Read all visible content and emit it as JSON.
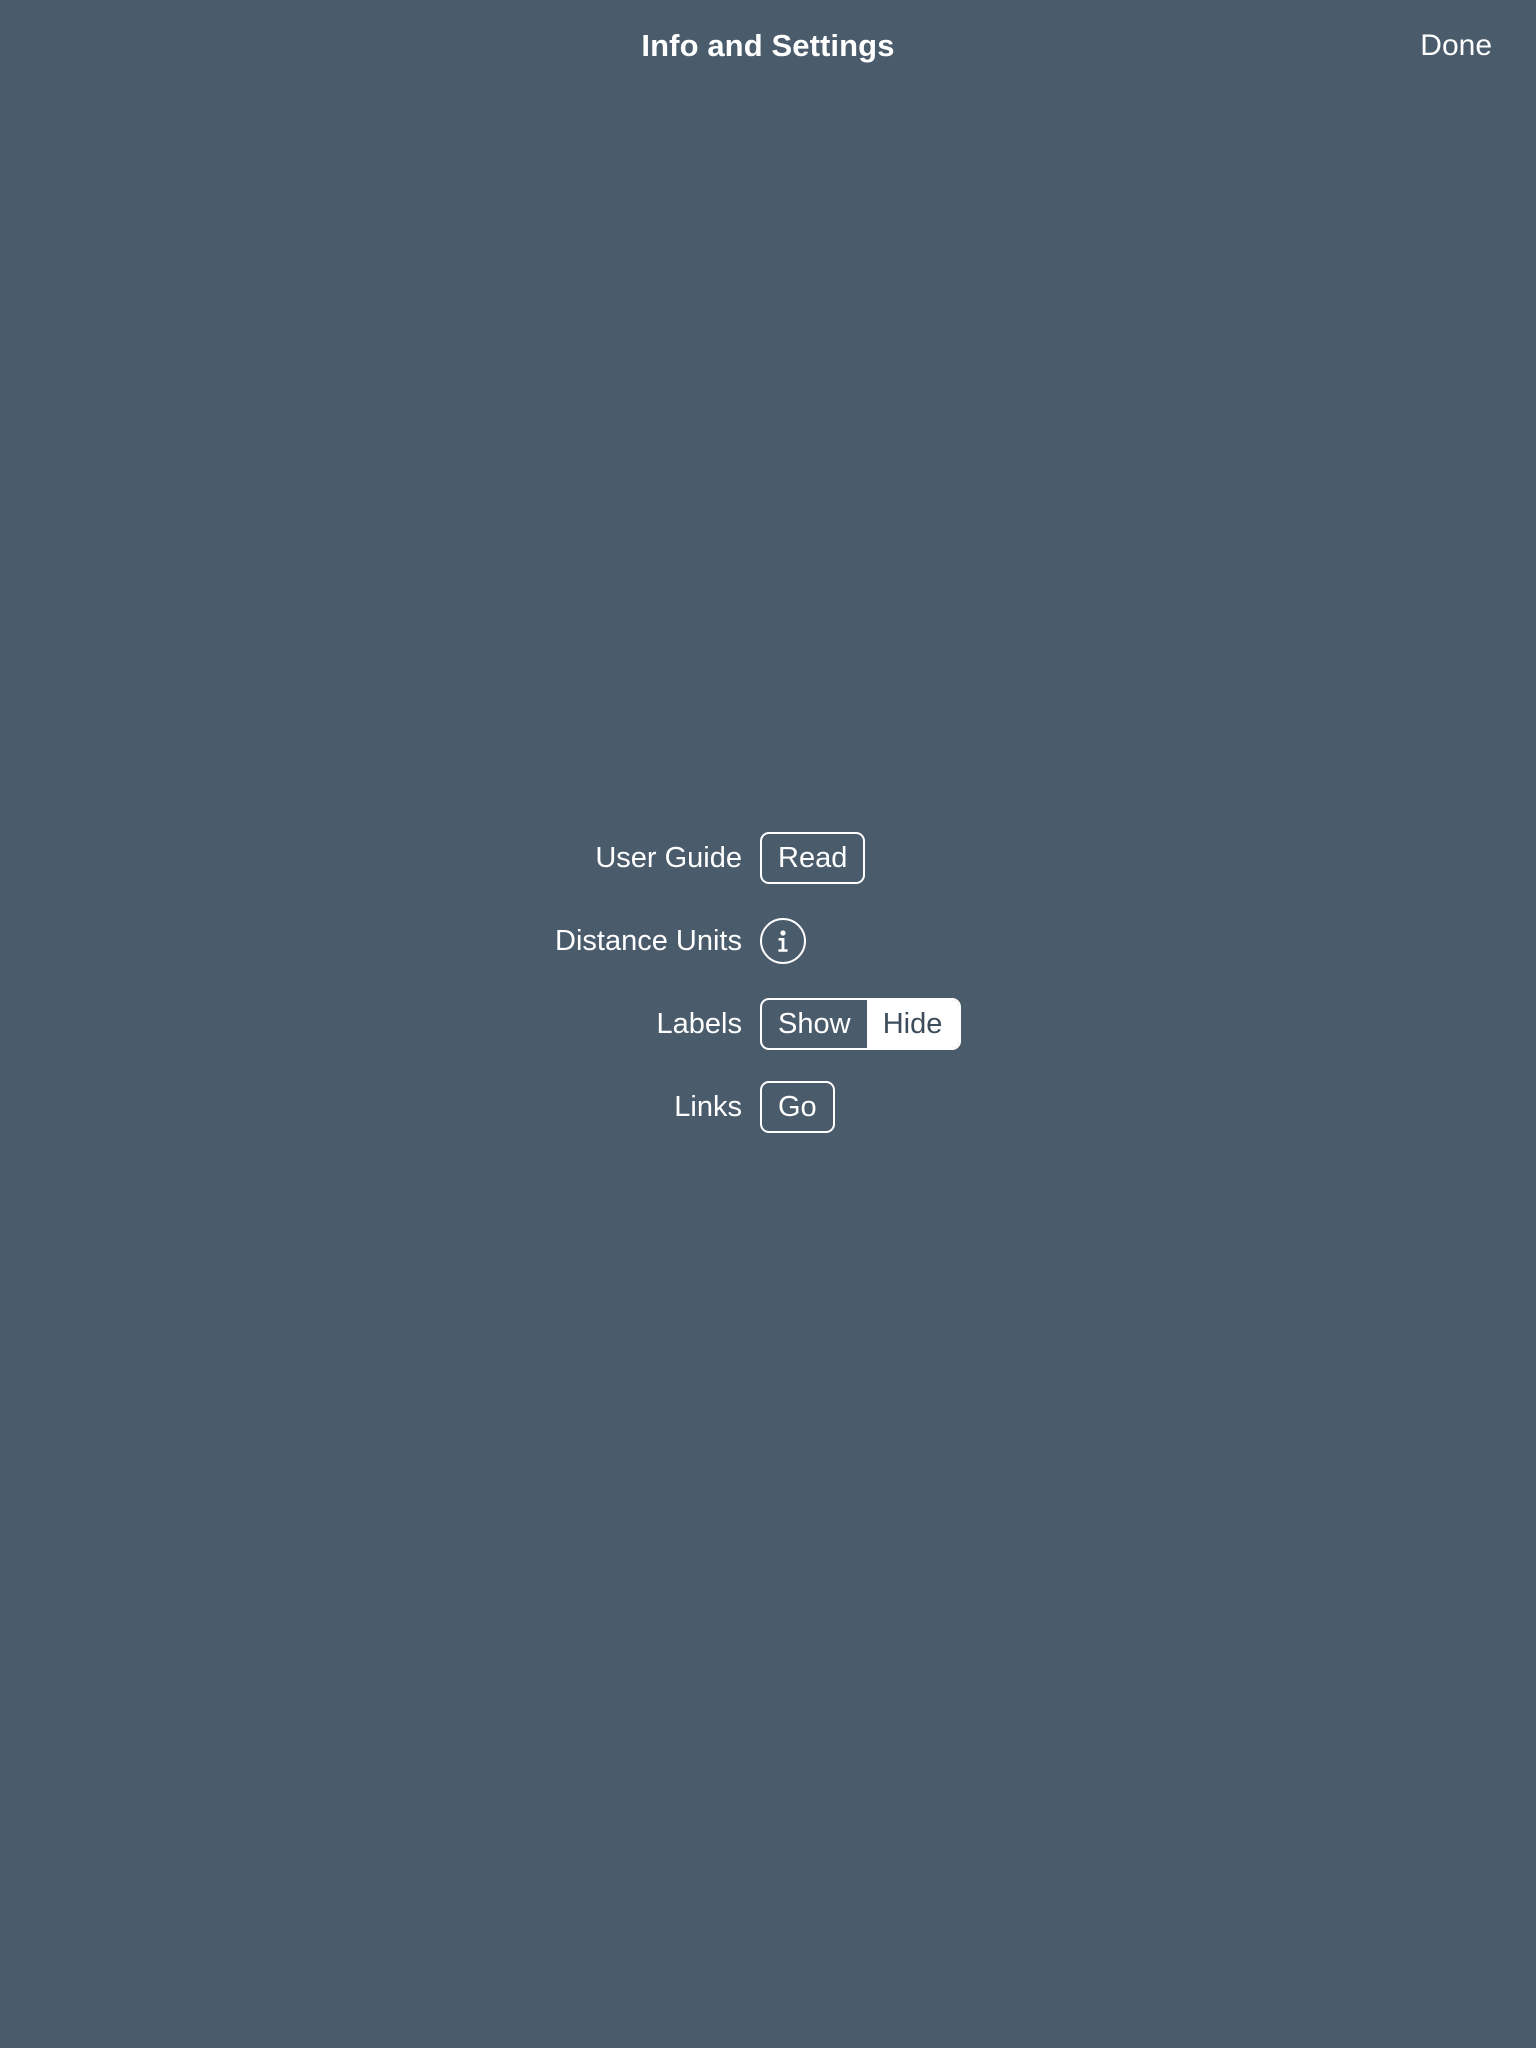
{
  "titlebar": {
    "title": "Info and Settings",
    "done_label": "Done"
  },
  "colors": {
    "background": "#4a5b6b",
    "foreground": "#ffffff",
    "selected_segment_background": "#ffffff",
    "selected_segment_text": "#3c4c5a"
  },
  "settings": {
    "rows": [
      {
        "label": "User Guide",
        "control": "button",
        "button_label": "Read",
        "icon": ""
      },
      {
        "label": "Distance Units",
        "control": "info-icon",
        "button_label": "",
        "icon": "info-circle-icon"
      },
      {
        "label": "Labels",
        "control": "segmented",
        "options": [
          {
            "label": "Show",
            "selected": false
          },
          {
            "label": "Hide",
            "selected": true
          }
        ]
      },
      {
        "label": "Links",
        "control": "button",
        "button_label": "Go",
        "icon": ""
      }
    ]
  }
}
